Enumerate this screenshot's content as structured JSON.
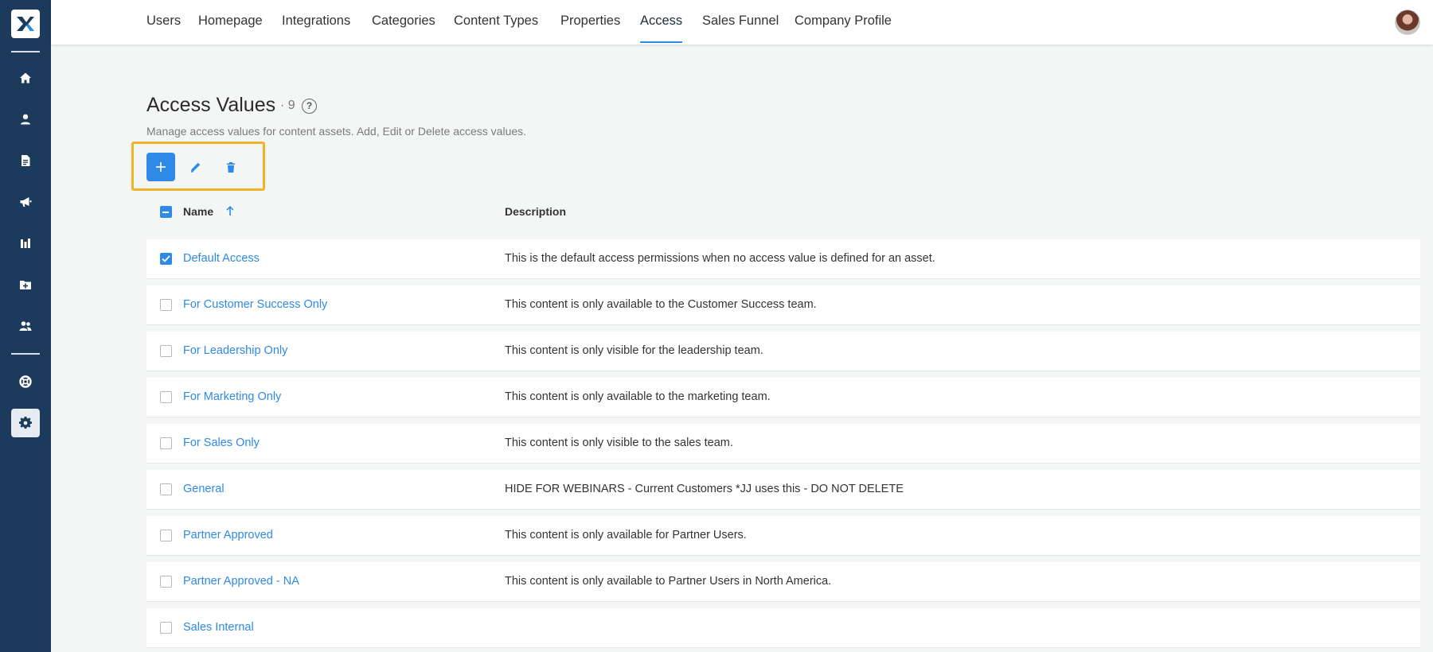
{
  "nav": {
    "tabs": [
      {
        "label": "Users"
      },
      {
        "label": "Homepage"
      },
      {
        "label": "Integrations"
      },
      {
        "label": "Categories"
      },
      {
        "label": "Content Types"
      },
      {
        "label": "Properties"
      },
      {
        "label": "Access",
        "active": true
      },
      {
        "label": "Sales Funnel"
      },
      {
        "label": "Company Profile"
      }
    ]
  },
  "sidebar": {
    "items": [
      {
        "icon": "home-icon"
      },
      {
        "icon": "user-icon"
      },
      {
        "icon": "document-icon"
      },
      {
        "icon": "megaphone-icon"
      },
      {
        "icon": "bar-chart-icon"
      },
      {
        "icon": "folder-add-icon"
      },
      {
        "icon": "users-icon"
      },
      {
        "icon": "lifebuoy-icon"
      },
      {
        "icon": "gear-icon",
        "active": true
      }
    ]
  },
  "header": {
    "title": "Access Values",
    "count": "· 9",
    "help": "?",
    "subtitle": "Manage access values for content assets. Add, Edit or Delete access values."
  },
  "toolbar": {
    "add_icon": "plus-icon",
    "edit_icon": "pencil-icon",
    "delete_icon": "trash-icon"
  },
  "table": {
    "columns": {
      "name": "Name",
      "description": "Description"
    },
    "sort": {
      "column": "Name",
      "direction": "ascending",
      "icon": "arrow-up-icon"
    },
    "rows": [
      {
        "name": "Default Access",
        "description": "This is the default access permissions when no access value is defined for an asset.",
        "checked": true
      },
      {
        "name": "For Customer Success Only",
        "description": "This content is only available to the Customer Success team.",
        "checked": false
      },
      {
        "name": "For Leadership Only",
        "description": "This content is only visible for the leadership team.",
        "checked": false
      },
      {
        "name": "For Marketing Only",
        "description": "This content is only available to the marketing team.",
        "checked": false
      },
      {
        "name": "For Sales Only",
        "description": "This content is only visible to the sales team.",
        "checked": false
      },
      {
        "name": "General",
        "description": "HIDE FOR WEBINARS - Current Customers *JJ uses this - DO NOT DELETE",
        "checked": false
      },
      {
        "name": "Partner Approved",
        "description": "This content is only available for Partner Users.",
        "checked": false
      },
      {
        "name": "Partner Approved - NA",
        "description": "This content is only available to Partner Users in North America.",
        "checked": false
      },
      {
        "name": "Sales Internal",
        "description": "",
        "checked": false
      }
    ]
  },
  "colors": {
    "sidebar": "#1b3a5c",
    "accent": "#2f89e6",
    "highlight": "#f0b429",
    "background": "#f4f6f6"
  }
}
